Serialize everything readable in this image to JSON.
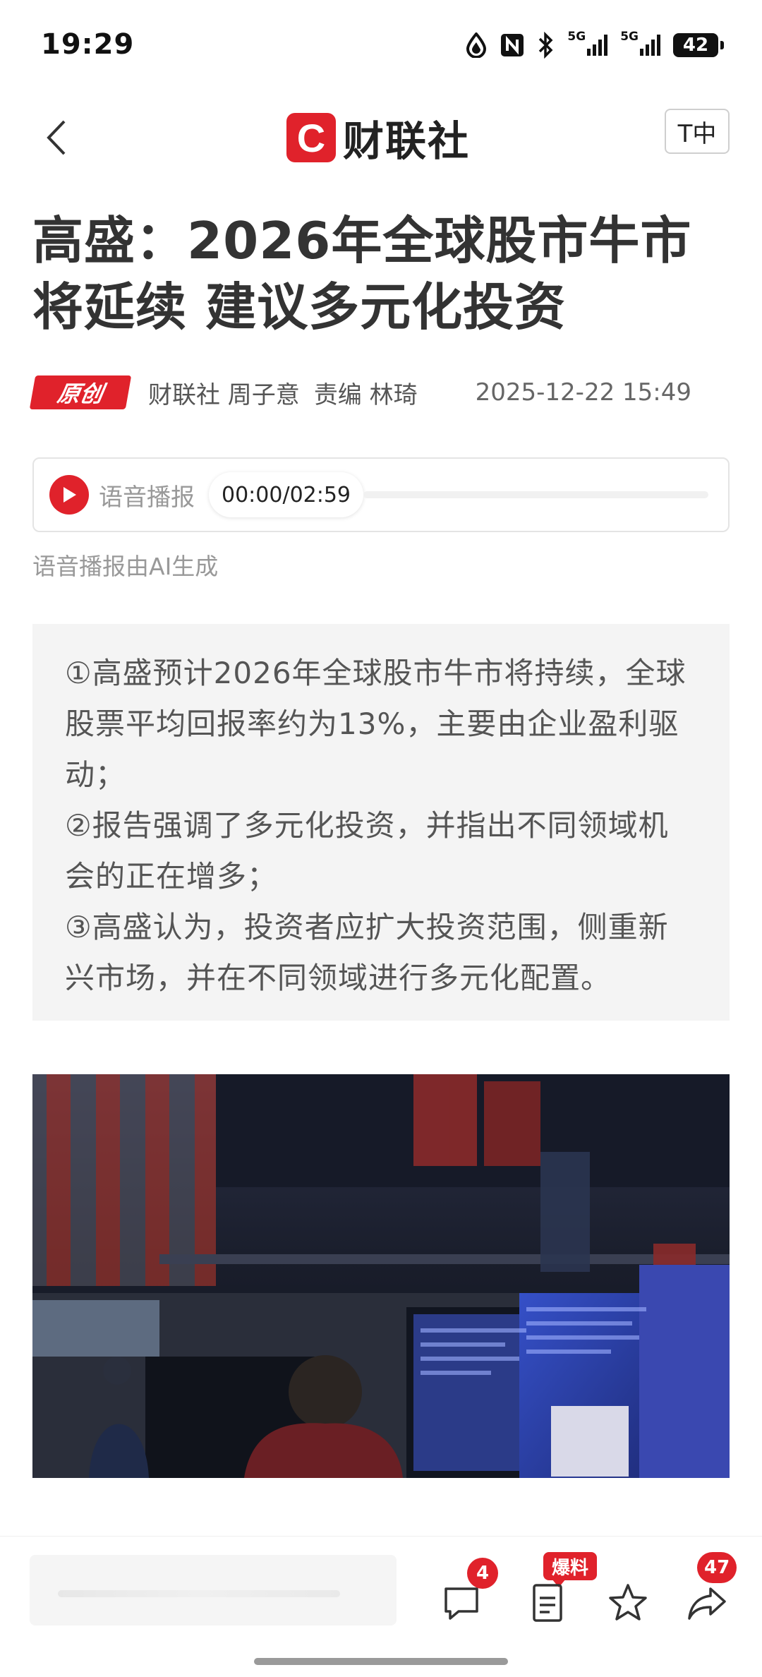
{
  "status_bar": {
    "time": "19:29",
    "net1": "5G",
    "net2": "5G",
    "battery": "42"
  },
  "header": {
    "logo_mark": "C",
    "logo_text": "财联社",
    "font_button": "T中"
  },
  "article": {
    "title": "高盛：2026年全球股市牛市将延续 建议多元化投资",
    "badge": "原创",
    "author": "财联社 周子意",
    "editor": "责编 林琦",
    "date": "2025-12-22 15:49"
  },
  "audio": {
    "label": "语音播报",
    "time": "00:00/02:59",
    "progress": 0,
    "note": "语音播报由AI生成"
  },
  "summary": {
    "items": [
      "①高盛预计2026年全球股市牛市将持续，全球股票平均回报率约为13%，主要由企业盈利驱动；",
      "②报告强调了多元化投资，并指出不同领域机会的正在增多；",
      "③高盛认为，投资者应扩大投资范围，侧重新兴市场，并在不同领域进行多元化配置。"
    ]
  },
  "bottom_bar": {
    "comment_count": "4",
    "tip_label": "爆料",
    "share_count": "47"
  },
  "icons": {
    "back": "chevron-left-icon",
    "play": "play-icon",
    "comment": "comment-icon",
    "tip": "document-edit-icon",
    "favorite": "star-icon",
    "share": "share-icon"
  },
  "colors": {
    "brand_red": "#e0222b",
    "title_text": "#333333",
    "summary_bg": "#f4f4f4"
  }
}
